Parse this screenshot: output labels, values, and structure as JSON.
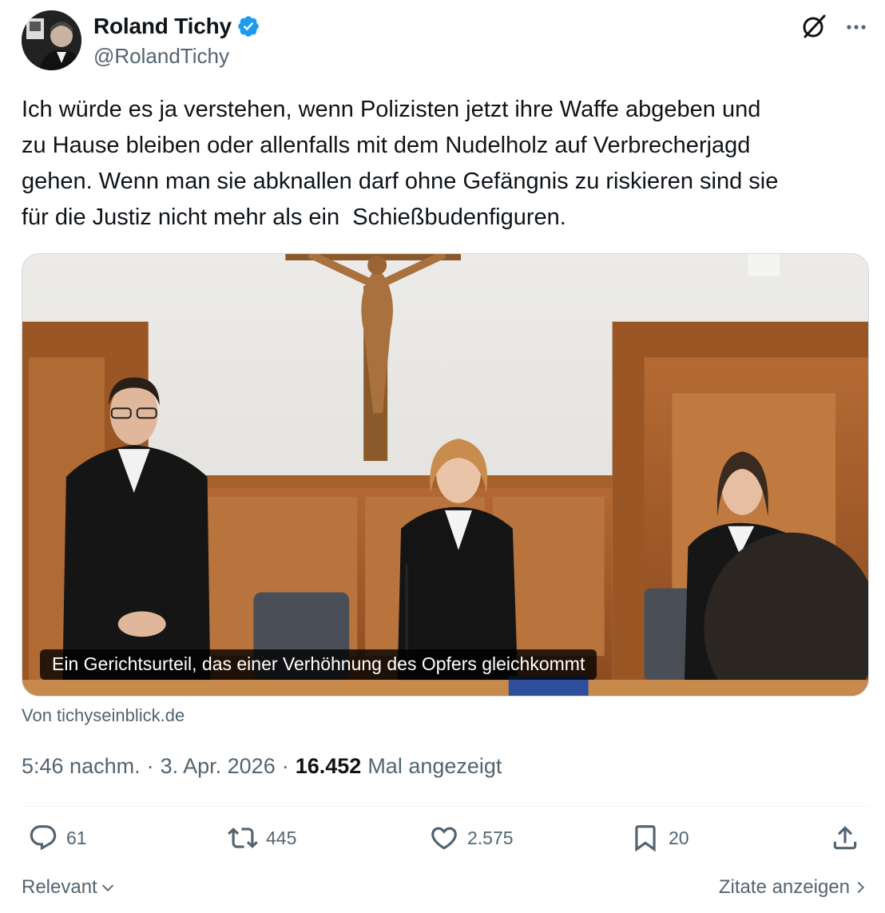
{
  "author": {
    "display_name": "Roland Tichy",
    "handle": "@RolandTichy"
  },
  "tweet": {
    "text": "Ich würde es ja verstehen, wenn Polizisten jetzt ihre Waffe abgeben und\nzu Hause bleiben oder allenfalls mit dem Nudelholz auf Verbrecherjagd\ngehen. Wenn man sie abknallen darf ohne Gefängnis zu riskieren sind sie\nfür die Justiz nicht mehr als ein  Schießbudenfiguren."
  },
  "card": {
    "caption": "Ein Gerichtsurteil, das einer Verhöhnung des Opfers gleichkommt",
    "source": "Von tichyseinblick.de"
  },
  "meta": {
    "time": "5:46 nachm.",
    "separator": "·",
    "date": "3. Apr. 2026",
    "views_count": "16.452",
    "views_label": "Mal angezeigt"
  },
  "actions": {
    "replies": "61",
    "reposts": "445",
    "likes": "2.575",
    "bookmarks": "20"
  },
  "footer": {
    "sort_label": "Relevant",
    "quotes_label": "Zitate anzeigen"
  },
  "icons": [
    "verified-badge-icon",
    "grok-icon",
    "more-icon",
    "reply-icon",
    "repost-icon",
    "like-icon",
    "bookmark-icon",
    "share-icon",
    "chevron-down-icon",
    "chevron-right-icon"
  ],
  "colors": {
    "text": "#0f1419",
    "secondary": "#536471",
    "verified": "#1d9bf0",
    "divider": "#eff3f4"
  }
}
